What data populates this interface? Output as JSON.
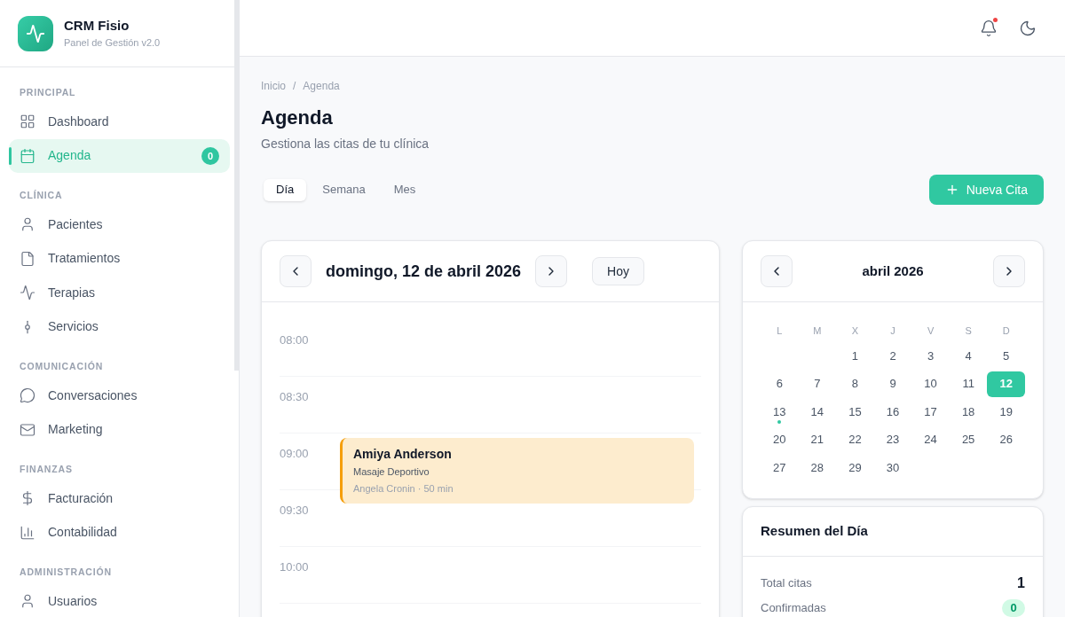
{
  "sidebar": {
    "brand": {
      "title": "CRM Fisio",
      "subtitle": "Panel de Gestión v2.0"
    },
    "sections": [
      {
        "label": "PRINCIPAL",
        "items": [
          {
            "label": "Dashboard",
            "selected": false
          },
          {
            "label": "Agenda",
            "selected": true,
            "badge": "0"
          }
        ]
      },
      {
        "label": "CLÍNICA",
        "items": [
          {
            "label": "Pacientes",
            "selected": false
          },
          {
            "label": "Tratamientos",
            "selected": false
          },
          {
            "label": "Terapias",
            "selected": false
          },
          {
            "label": "Servicios",
            "selected": false
          }
        ]
      },
      {
        "label": "COMUNICACIÓN",
        "items": [
          {
            "label": "Conversaciones",
            "selected": false
          },
          {
            "label": "Marketing",
            "selected": false
          }
        ]
      },
      {
        "label": "FINANZAS",
        "items": [
          {
            "label": "Facturación",
            "selected": false
          },
          {
            "label": "Contabilidad",
            "selected": false
          }
        ]
      },
      {
        "label": "ADMINISTRACIÓN",
        "items": [
          {
            "label": "Usuarios",
            "selected": false
          }
        ]
      }
    ]
  },
  "header": {
    "notifications": {
      "unread": true
    }
  },
  "breadcrumb": {
    "items": [
      "Inicio",
      "Agenda"
    ],
    "separator": "/"
  },
  "page": {
    "title": "Agenda",
    "subtitle": "Gestiona las citas de tu clínica"
  },
  "view_tabs": [
    {
      "label": "Día",
      "selected": true
    },
    {
      "label": "Semana",
      "selected": false
    },
    {
      "label": "Mes",
      "selected": false
    }
  ],
  "new_button": {
    "label": "Nueva Cita"
  },
  "day_view": {
    "title": "domingo, 12 de abril 2026",
    "today_button": "Hoy",
    "slots": [
      {
        "time": "08:00"
      },
      {
        "time": "08:30"
      },
      {
        "time": "09:00",
        "appointments": [
          {
            "patient": "Amiya Anderson",
            "service": "Masaje Deportivo",
            "detail": "Angela Cronin · 50 min",
            "color": "#f59e0b"
          }
        ]
      },
      {
        "time": "09:30"
      },
      {
        "time": "10:00"
      }
    ]
  },
  "mini_calendar": {
    "title": "abril 2026",
    "weekdays": [
      "L",
      "M",
      "X",
      "J",
      "V",
      "S",
      "D"
    ],
    "weeks": [
      [
        {
          "label": "1",
          "selected": false,
          "has_events": false
        },
        {
          "label": "2",
          "selected": false,
          "has_events": false
        },
        {
          "label": "3",
          "selected": false,
          "has_events": false
        },
        {
          "label": "4",
          "selected": false,
          "has_events": false
        },
        {
          "label": "5",
          "selected": false,
          "has_events": false
        }
      ],
      [
        {
          "label": "6",
          "selected": false,
          "has_events": false
        },
        {
          "label": "7",
          "selected": false,
          "has_events": false
        },
        {
          "label": "8",
          "selected": false,
          "has_events": false
        },
        {
          "label": "9",
          "selected": false,
          "has_events": false
        },
        {
          "label": "10",
          "selected": false,
          "has_events": false
        },
        {
          "label": "11",
          "selected": false,
          "has_events": false
        },
        {
          "label": "12",
          "selected": true,
          "has_events": false
        }
      ],
      [
        {
          "label": "13",
          "selected": false,
          "has_events": true
        },
        {
          "label": "14",
          "selected": false,
          "has_events": false
        },
        {
          "label": "15",
          "selected": false,
          "has_events": false
        },
        {
          "label": "16",
          "selected": false,
          "has_events": false
        },
        {
          "label": "17",
          "selected": false,
          "has_events": false
        },
        {
          "label": "18",
          "selected": false,
          "has_events": false
        },
        {
          "label": "19",
          "selected": false,
          "has_events": false
        }
      ],
      [
        {
          "label": "20",
          "selected": false,
          "has_events": false
        },
        {
          "label": "21",
          "selected": false,
          "has_events": false
        },
        {
          "label": "22",
          "selected": false,
          "has_events": false
        },
        {
          "label": "23",
          "selected": false,
          "has_events": false
        },
        {
          "label": "24",
          "selected": false,
          "has_events": false
        },
        {
          "label": "25",
          "selected": false,
          "has_events": false
        },
        {
          "label": "26",
          "selected": false,
          "has_events": false
        }
      ],
      [
        {
          "label": "27",
          "selected": false,
          "has_events": false
        },
        {
          "label": "28",
          "selected": false,
          "has_events": false
        },
        {
          "label": "29",
          "selected": false,
          "has_events": false
        },
        {
          "label": "30",
          "selected": false,
          "has_events": false
        }
      ]
    ]
  },
  "summary": {
    "title": "Resumen del Día",
    "rows": [
      {
        "label": "Total citas",
        "value": "1",
        "kind": "plain"
      },
      {
        "label": "Confirmadas",
        "value": "0",
        "kind": "badge"
      }
    ]
  }
}
